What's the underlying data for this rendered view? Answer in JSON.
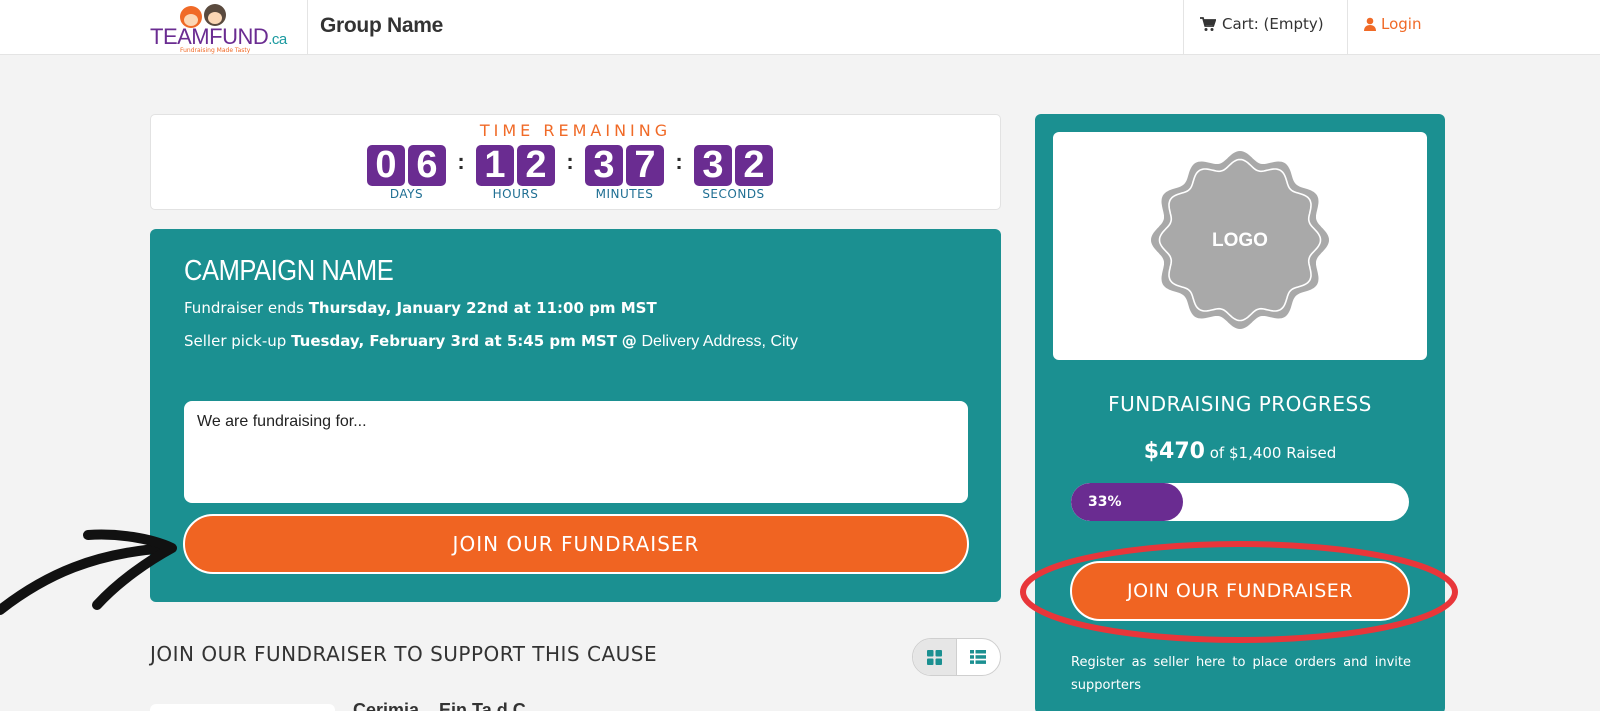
{
  "header": {
    "logo": {
      "team": "TEAM",
      "fund": "FUND",
      "ca": ".ca",
      "tagline": "Fundraising Made Tasty"
    },
    "group_name": "Group Name",
    "cart_label": "Cart: (Empty)",
    "login_label": "Login"
  },
  "timer": {
    "title": "TIME REMAINING",
    "units": [
      {
        "digits": [
          "0",
          "6"
        ],
        "label": "DAYS"
      },
      {
        "digits": [
          "1",
          "2"
        ],
        "label": "HOURS"
      },
      {
        "digits": [
          "3",
          "7"
        ],
        "label": "MINUTES"
      },
      {
        "digits": [
          "3",
          "2"
        ],
        "label": "SECONDS"
      }
    ],
    "separator": ":"
  },
  "campaign": {
    "name": "CAMPAIGN NAME",
    "ends_prefix": "Fundraiser ends",
    "ends_value": "Thursday, January 22nd at 11:00 pm MST",
    "pickup_prefix": "Seller pick-up",
    "pickup_value": "Tuesday, February 3rd at 5:45 pm MST",
    "pickup_at": "@",
    "pickup_address": "Delivery Address, City",
    "about_text": "We are fundraising for...",
    "join_label": "JOIN OUR FUNDRAISER"
  },
  "support_heading": "JOIN OUR FUNDRAISER TO SUPPORT THIS CAUSE",
  "product_title_partial": "Cerimia... Ein Ta d C",
  "sidebar": {
    "logo_label": "LOGO",
    "progress_title": "FUNDRAISING PROGRESS",
    "raised_amount": "$470",
    "raised_suffix": "of $1,400 Raised",
    "progress_value": 0.33,
    "progress_label": "33%",
    "join_label": "JOIN OUR FUNDRAISER",
    "register_text": "Register as seller here to place orders and invite supporters"
  },
  "colors": {
    "teal": "#1b9091",
    "purple": "#6a2c91",
    "orange": "#f06422",
    "annotation_red": "#e8363a"
  },
  "icons": {
    "cart": "cart-icon",
    "login": "user-icon",
    "grid_view": "grid-view-icon",
    "list_view": "list-view-icon"
  }
}
